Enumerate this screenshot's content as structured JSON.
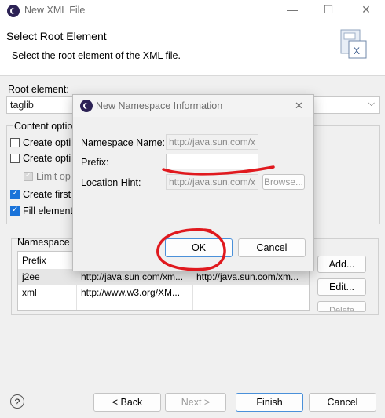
{
  "window": {
    "title": "New XML File",
    "minimize": "—",
    "maximize": "☐",
    "close": "✕"
  },
  "header": {
    "title": "Select Root Element",
    "description": "Select the root element of the XML file."
  },
  "root": {
    "label": "Root element:",
    "value": "taglib"
  },
  "content_options": {
    "legend": "Content optio",
    "items": [
      {
        "label": "Create opti",
        "checked": false,
        "disabled": false
      },
      {
        "label": "Create opti",
        "checked": false,
        "disabled": false
      },
      {
        "label": "Limit op",
        "checked": true,
        "disabled": true
      },
      {
        "label": "Create first",
        "checked": true,
        "disabled": false
      },
      {
        "label": "Fill element",
        "checked": true,
        "disabled": false
      }
    ]
  },
  "namespace": {
    "legend": "Namespace I",
    "columns": [
      "Prefix",
      "",
      ""
    ],
    "rows": [
      {
        "prefix": "j2ee",
        "uri": "http://java.sun.com/xm...",
        "location": "http://java.sun.com/xm..."
      },
      {
        "prefix": "xml",
        "uri": "http://www.w3.org/XM...",
        "location": ""
      }
    ],
    "buttons": {
      "add": "Add...",
      "edit": "Edit...",
      "delete": "Delete"
    }
  },
  "footer": {
    "help": "?",
    "back": "< Back",
    "next": "Next >",
    "finish": "Finish",
    "cancel": "Cancel"
  },
  "dialog": {
    "title": "New Namespace Information",
    "close": "✕",
    "namespace_label": "Namespace Name:",
    "namespace_value": "http://java.sun.com/x",
    "prefix_label": "Prefix:",
    "prefix_value": "",
    "location_label": "Location Hint:",
    "location_value": "http://java.sun.com/x",
    "browse": "Browse...",
    "ok": "OK",
    "cancel": "Cancel"
  },
  "annotation_color": "#e0191e"
}
